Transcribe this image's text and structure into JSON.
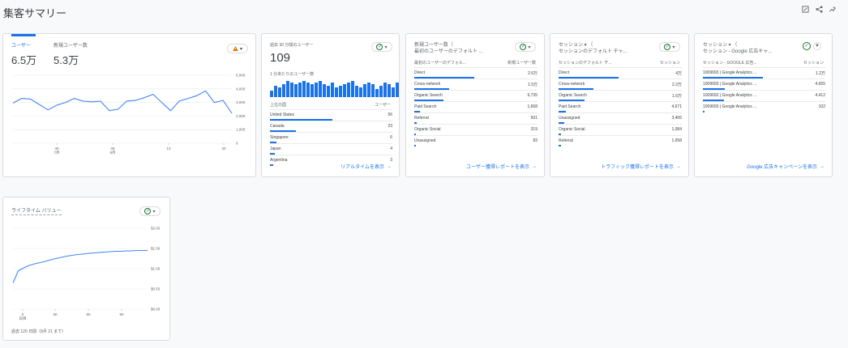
{
  "header": {
    "title": "集客サマリー",
    "icons": [
      "report-icon",
      "share-icon",
      "insights-icon"
    ]
  },
  "card_users": {
    "metrics": [
      {
        "label": "ユーザー",
        "value": "6.5万"
      },
      {
        "label": "新規ユーザー数",
        "value": "5.3万"
      }
    ],
    "chart_data": {
      "type": "line",
      "x_ticks": [
        "30\n7月",
        "06\n8月",
        "13",
        "20"
      ],
      "y_ticks": [
        "5,000",
        "4,000",
        "3,000",
        "2,000",
        "1,000",
        "0"
      ],
      "ylim": [
        0,
        5000
      ],
      "values": [
        2950,
        3300,
        3250,
        2850,
        2450,
        2800,
        3000,
        3300,
        3100,
        3050,
        3100,
        2400,
        2500,
        3100,
        3150,
        3350,
        3600,
        3000,
        2400,
        3100,
        3300,
        3500,
        3850,
        3000,
        3150,
        2200
      ]
    }
  },
  "card_realtime": {
    "title": "過去 30 分間のユーザー",
    "value": "109",
    "sub": "1 分あたりのユーザー数",
    "bars": [
      4,
      7,
      6,
      8,
      10,
      9,
      8,
      9,
      10,
      9,
      8,
      9,
      10,
      8,
      7,
      9,
      6,
      7,
      8,
      9,
      10,
      7,
      6,
      8,
      9,
      8,
      5,
      7,
      9,
      8,
      6,
      9
    ],
    "col_country": "上位の国",
    "col_users": "ユーザー",
    "rows": [
      {
        "name": "United States",
        "value": "56",
        "pct": 0.55
      },
      {
        "name": "Canada",
        "value": "23",
        "pct": 0.23
      },
      {
        "name": "Singapore",
        "value": "6",
        "pct": 0.06
      },
      {
        "name": "Japan",
        "value": "4",
        "pct": 0.04
      },
      {
        "name": "Argentina",
        "value": "3",
        "pct": 0.03
      }
    ],
    "link": "リアルタイムを表示"
  },
  "card_newusers": {
    "title_line1": "新規ユーザー数（",
    "title_line2": "最初のユーザーのデフォルト ...",
    "col1": "最初のユーザーのデフォル...",
    "col2": "新規ユーザー数",
    "rows": [
      {
        "name": "Direct",
        "value": "2.6万",
        "pct": 0.55
      },
      {
        "name": "Cross-network",
        "value": "1.5万",
        "pct": 0.32
      },
      {
        "name": "Organic Search",
        "value": "9,735",
        "pct": 0.27
      },
      {
        "name": "Paid Search",
        "value": "1,668",
        "pct": 0.05
      },
      {
        "name": "Referral",
        "value": "501",
        "pct": 0.02
      },
      {
        "name": "Organic Social",
        "value": "319",
        "pct": 0.01
      },
      {
        "name": "Unassigned",
        "value": "83",
        "pct": 0.005
      }
    ],
    "link": "ユーザー獲得レポートを表示"
  },
  "card_sessions": {
    "title_line1": "セッション ▾ （",
    "title_line2": "セッションのデフォルト チャ...",
    "col1": "セッションのデフォルト チ...",
    "col2": "セッション",
    "rows": [
      {
        "name": "Direct",
        "value": "4万",
        "pct": 0.55
      },
      {
        "name": "Cross-network",
        "value": "2.2万",
        "pct": 0.32
      },
      {
        "name": "Organic Search",
        "value": "1.6万",
        "pct": 0.24
      },
      {
        "name": "Paid Search",
        "value": "4,671",
        "pct": 0.07
      },
      {
        "name": "Unassigned",
        "value": "3,406",
        "pct": 0.05
      },
      {
        "name": "Organic Social",
        "value": "1,084",
        "pct": 0.02
      },
      {
        "name": "Referral",
        "value": "1,058",
        "pct": 0.02
      }
    ],
    "link": "トラフィック獲得レポートを表示"
  },
  "card_google_ads": {
    "title_line1": "セッション ▾ （",
    "title_line2": "セッション - Google 広告キャ...",
    "col1": "セッション - GOOGLE 広告...",
    "col2": "セッション",
    "rows": [
      {
        "name": "1009693 | Google Analytics ...",
        "value": "1.2万",
        "pct": 0.55
      },
      {
        "name": "1009693 | Google Analytics ...",
        "value": "4,655",
        "pct": 0.2
      },
      {
        "name": "1009693 | Google Analytics ...",
        "value": "4,412",
        "pct": 0.19
      },
      {
        "name": "1009693 | Google Analytics ...",
        "value": "102",
        "pct": 0.01
      }
    ],
    "link": "Google 広告キャンペーンを表示"
  },
  "card_ltv": {
    "title": "ライフタイム バリュー",
    "footer": "過去 120 日間（8月 21 まで）",
    "chart_data": {
      "type": "line",
      "x_ticks": [
        "0\n日目",
        "30",
        "60",
        "90"
      ],
      "y_ticks": [
        "$2.00",
        "$1.50",
        "$1.00",
        "$0.50",
        "$0.00"
      ],
      "ylim": [
        0,
        2
      ],
      "values": [
        0.65,
        0.95,
        1.02,
        1.08,
        1.12,
        1.15,
        1.18,
        1.22,
        1.25,
        1.28,
        1.31,
        1.33,
        1.35,
        1.36,
        1.38,
        1.39,
        1.4,
        1.41,
        1.42,
        1.43,
        1.43,
        1.44,
        1.44,
        1.45,
        1.45,
        1.45
      ]
    }
  },
  "colors": {
    "accent": "#1a73e8",
    "line": "#4285f4",
    "warn": "#e37400",
    "ok": "#137333"
  }
}
